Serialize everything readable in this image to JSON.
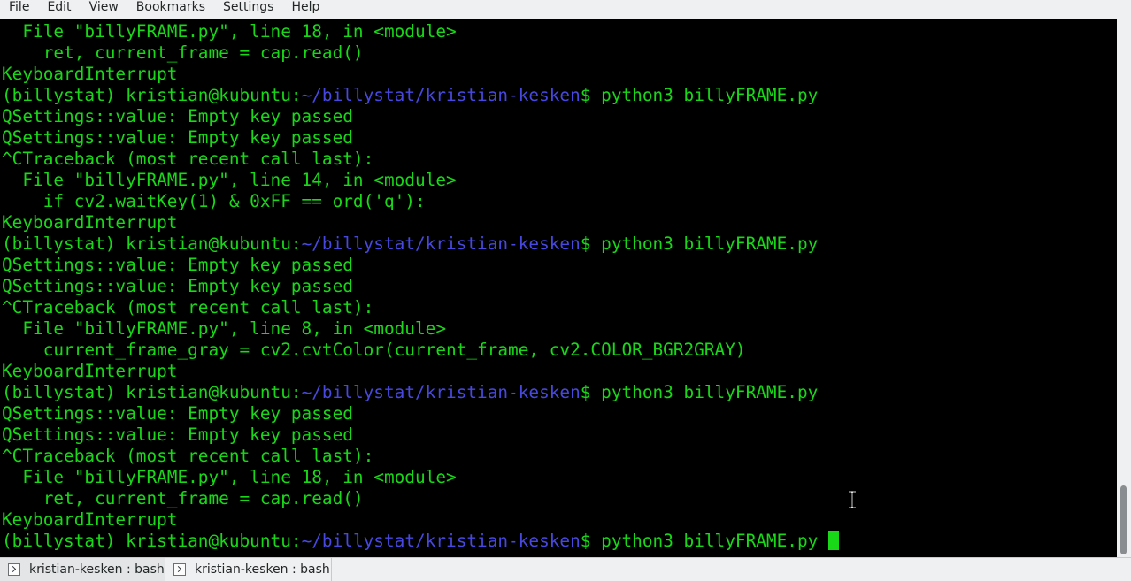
{
  "menu": {
    "items": [
      "File",
      "Edit",
      "View",
      "Bookmarks",
      "Settings",
      "Help"
    ]
  },
  "terminal": {
    "colors": {
      "output": "#18d818",
      "path": "#4848e0",
      "background": "#000000"
    },
    "lines": [
      {
        "text": "  File \"billyFRAME.py\", line 18, in <module>"
      },
      {
        "text": "    ret, current_frame = cap.read()"
      },
      {
        "text": "KeyboardInterrupt"
      },
      {
        "prompt": {
          "env": "(billystat) kristian@kubuntu",
          "sep": ":",
          "path": "~/billystat/kristian-kesken",
          "dollar": "$",
          "cmd": " python3 billyFRAME.py"
        }
      },
      {
        "text": "QSettings::value: Empty key passed"
      },
      {
        "text": "QSettings::value: Empty key passed"
      },
      {
        "text": "^CTraceback (most recent call last):"
      },
      {
        "text": "  File \"billyFRAME.py\", line 14, in <module>"
      },
      {
        "text": "    if cv2.waitKey(1) & 0xFF == ord('q'):"
      },
      {
        "text": "KeyboardInterrupt"
      },
      {
        "prompt": {
          "env": "(billystat) kristian@kubuntu",
          "sep": ":",
          "path": "~/billystat/kristian-kesken",
          "dollar": "$",
          "cmd": " python3 billyFRAME.py"
        }
      },
      {
        "text": "QSettings::value: Empty key passed"
      },
      {
        "text": "QSettings::value: Empty key passed"
      },
      {
        "text": "^CTraceback (most recent call last):"
      },
      {
        "text": "  File \"billyFRAME.py\", line 8, in <module>"
      },
      {
        "text": "    current_frame_gray = cv2.cvtColor(current_frame, cv2.COLOR_BGR2GRAY)"
      },
      {
        "text": "KeyboardInterrupt"
      },
      {
        "prompt": {
          "env": "(billystat) kristian@kubuntu",
          "sep": ":",
          "path": "~/billystat/kristian-kesken",
          "dollar": "$",
          "cmd": " python3 billyFRAME.py"
        }
      },
      {
        "text": "QSettings::value: Empty key passed"
      },
      {
        "text": "QSettings::value: Empty key passed"
      },
      {
        "text": "^CTraceback (most recent call last):"
      },
      {
        "text": "  File \"billyFRAME.py\", line 18, in <module>"
      },
      {
        "text": "    ret, current_frame = cap.read()"
      },
      {
        "text": "KeyboardInterrupt"
      },
      {
        "prompt": {
          "env": "(billystat) kristian@kubuntu",
          "sep": ":",
          "path": "~/billystat/kristian-kesken",
          "dollar": "$",
          "cmd": " python3 billyFRAME.py "
        },
        "cursor": true
      }
    ]
  },
  "scrollbar": {
    "position": "bottom"
  },
  "tabs": [
    {
      "label": "kristian-kesken : bash",
      "icon": "terminal-icon",
      "active": true
    },
    {
      "label": "kristian-kesken : bash",
      "icon": "terminal-icon",
      "active": false
    }
  ]
}
